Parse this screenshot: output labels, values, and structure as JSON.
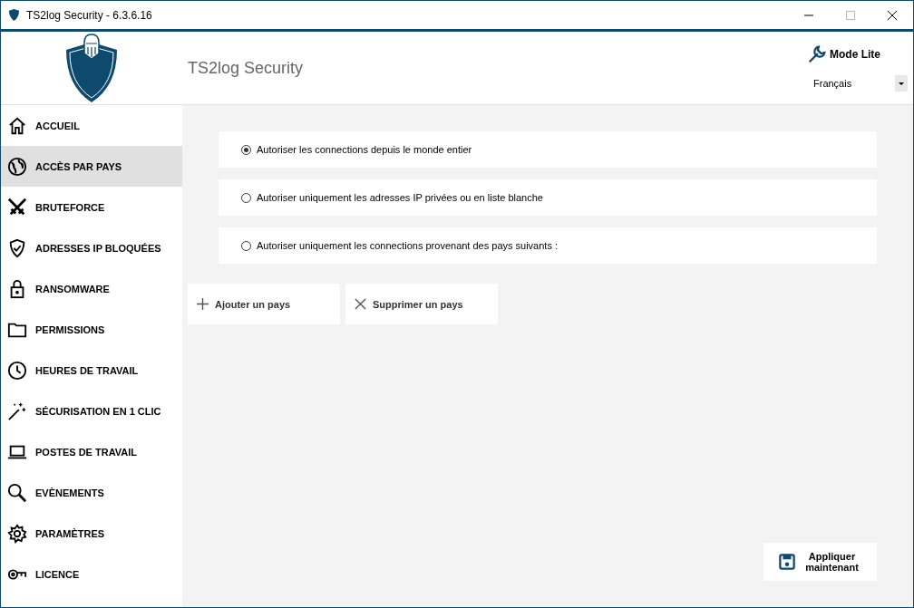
{
  "window": {
    "title": "TS2log Security - 6.3.6.16"
  },
  "header": {
    "app_name": "TS2log Security",
    "mode_button": "Mode Lite",
    "language": "Français"
  },
  "sidebar": {
    "items": [
      {
        "label": "ACCUEIL",
        "selected": false
      },
      {
        "label": "ACCÈS PAR PAYS",
        "selected": true
      },
      {
        "label": "BRUTEFORCE",
        "selected": false
      },
      {
        "label": "ADRESSES IP BLOQUÉES",
        "selected": false
      },
      {
        "label": "RANSOMWARE",
        "selected": false
      },
      {
        "label": "PERMISSIONS",
        "selected": false
      },
      {
        "label": "HEURES DE TRAVAIL",
        "selected": false
      },
      {
        "label": "SÉCURISATION EN 1 CLIC",
        "selected": false
      },
      {
        "label": "POSTES DE TRAVAIL",
        "selected": false
      },
      {
        "label": "EVÈNEMENTS",
        "selected": false
      },
      {
        "label": "PARAMÈTRES",
        "selected": false
      },
      {
        "label": "LICENCE",
        "selected": false
      }
    ]
  },
  "options": [
    {
      "label": "Autoriser les connections depuis le monde entier",
      "selected": true
    },
    {
      "label": "Autoriser uniquement les adresses IP privées ou en liste blanche",
      "selected": false
    },
    {
      "label": "Autoriser uniquement les connections provenant des pays suivants :",
      "selected": false
    }
  ],
  "country_buttons": [
    {
      "kind": "add",
      "label": "Ajouter un pays"
    },
    {
      "kind": "remove",
      "label": "Supprimer un pays"
    }
  ],
  "apply_button": {
    "label": "Appliquer maintenant"
  }
}
